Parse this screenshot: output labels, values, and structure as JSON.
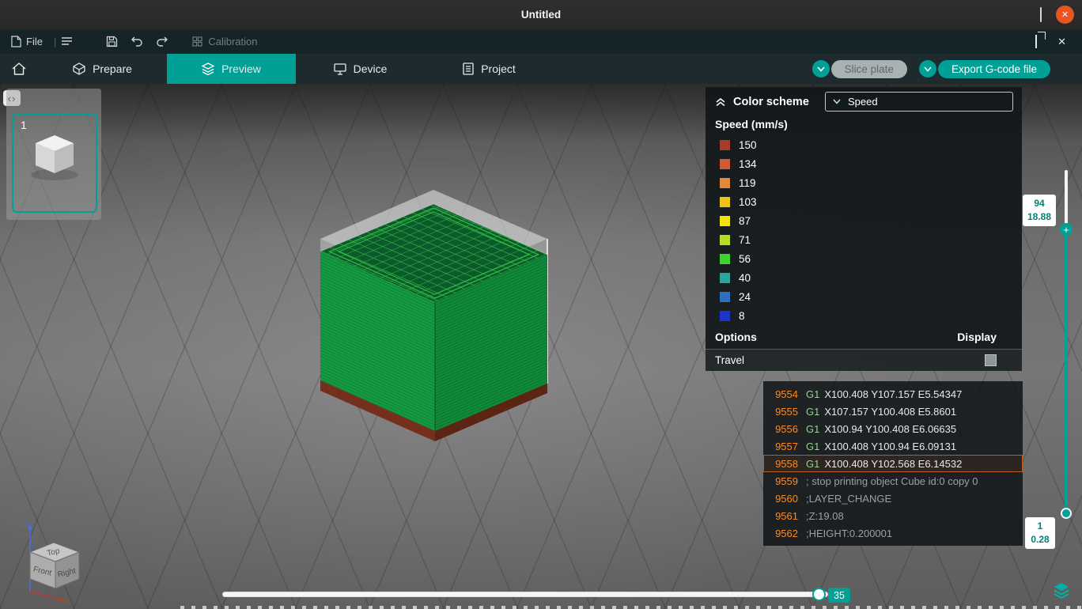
{
  "window": {
    "title": "Untitled"
  },
  "icons": {
    "close": "✕",
    "panel_toggle": "‹›",
    "plus": "+",
    "menu_separator": "|"
  },
  "colors": {
    "accent": "#00a096",
    "close_button": "#e95420",
    "gcode_line_number": "#ff8a1e",
    "gcode_highlight_border": "#b85c21"
  },
  "menubar": {
    "file_label": "File",
    "calibration_label": "Calibration"
  },
  "tabs": {
    "prepare": "Prepare",
    "preview": "Preview",
    "device": "Device",
    "project": "Project"
  },
  "actions": {
    "slice_plate": "Slice plate",
    "export_gcode": "Export G-code file"
  },
  "plate": {
    "number": "1"
  },
  "legend": {
    "header": "Color scheme",
    "dropdown_value": "Speed",
    "section_title": "Speed (mm/s)",
    "items": [
      {
        "color": "#a93b2a",
        "label": "150"
      },
      {
        "color": "#cf5a33",
        "label": "134"
      },
      {
        "color": "#e28a37",
        "label": "119"
      },
      {
        "color": "#ecc215",
        "label": "103"
      },
      {
        "color": "#f2e30c",
        "label": "87"
      },
      {
        "color": "#b4df25",
        "label": "71"
      },
      {
        "color": "#3bd42c",
        "label": "56"
      },
      {
        "color": "#27a89a",
        "label": "40"
      },
      {
        "color": "#2b70c2",
        "label": "24"
      },
      {
        "color": "#1d33cd",
        "label": "8"
      }
    ],
    "options_label": "Options",
    "display_label": "Display",
    "travel_label": "Travel"
  },
  "gcode": {
    "lines": [
      {
        "num": "9554",
        "cmd": "G1",
        "args": "X100.408 Y107.157 E5.54347",
        "kind": "cmd",
        "hl": false
      },
      {
        "num": "9555",
        "cmd": "G1",
        "args": "X107.157 Y100.408 E5.8601",
        "kind": "cmd",
        "hl": false
      },
      {
        "num": "9556",
        "cmd": "G1",
        "args": "X100.94 Y100.408 E6.06635",
        "kind": "cmd",
        "hl": false
      },
      {
        "num": "9557",
        "cmd": "G1",
        "args": "X100.408 Y100.94 E6.09131",
        "kind": "cmd",
        "hl": false
      },
      {
        "num": "9558",
        "cmd": "G1",
        "args": "X100.408 Y102.568 E6.14532",
        "kind": "cmd",
        "hl": true
      },
      {
        "num": "9559",
        "cmd": "",
        "args": "; stop printing object Cube id:0 copy 0",
        "kind": "comment",
        "hl": false
      },
      {
        "num": "9560",
        "cmd": "",
        "args": ";LAYER_CHANGE",
        "kind": "comment",
        "hl": false
      },
      {
        "num": "9561",
        "cmd": "",
        "args": ";Z:19.08",
        "kind": "comment",
        "hl": false
      },
      {
        "num": "9562",
        "cmd": "",
        "args": ";HEIGHT:0.200001",
        "kind": "comment",
        "hl": false
      }
    ]
  },
  "vertical_slider": {
    "top_value": "94",
    "top_height": "18.88",
    "bottom_value": "1",
    "bottom_height": "0.28"
  },
  "horizontal_slider": {
    "value": "35"
  },
  "nav_cube": {
    "top": "Top",
    "front": "Front",
    "right": "Right",
    "axis_x": "x",
    "axis_z": "z"
  }
}
